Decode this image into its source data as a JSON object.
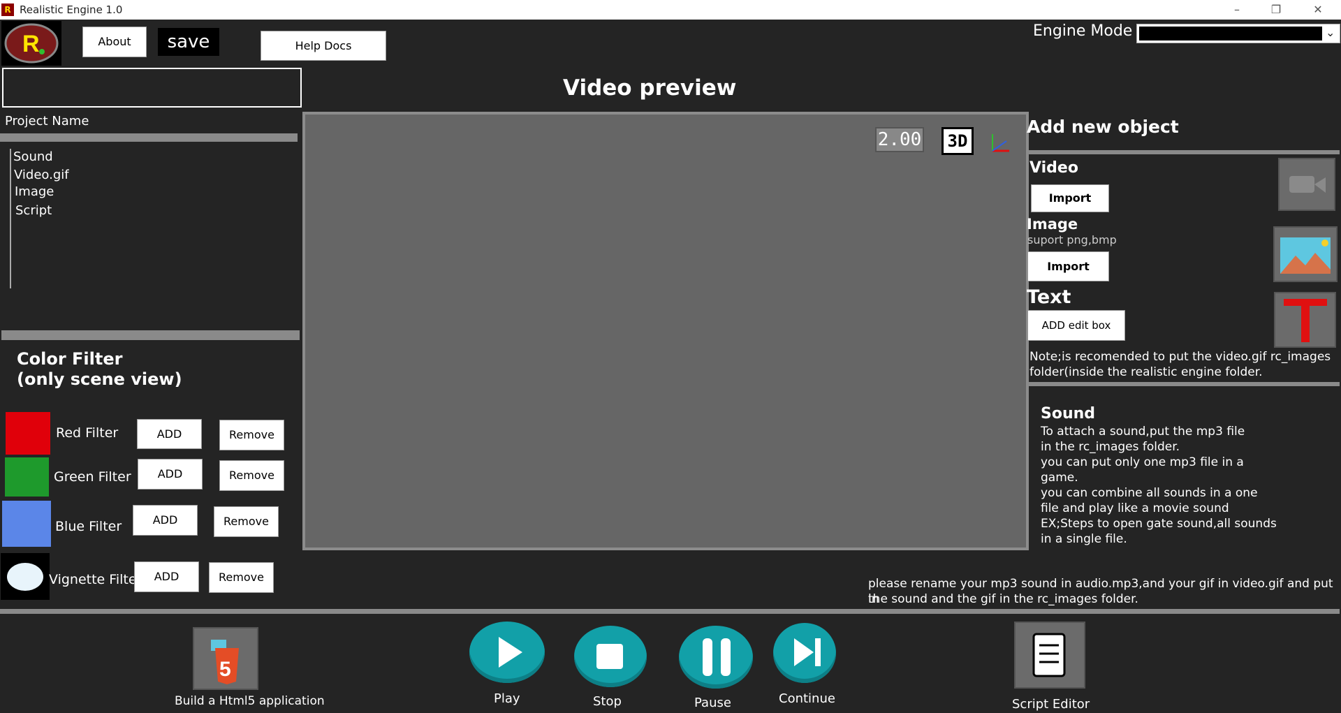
{
  "window": {
    "title": "Realistic Engine 1.0",
    "logo_letter": "R"
  },
  "toolbar": {
    "about": "About",
    "save": "save",
    "help": "Help Docs",
    "engine_mode_label": "Engine Mode",
    "engine_mode_value": ""
  },
  "project": {
    "name_label": "Project Name",
    "name_value": "",
    "items": [
      "Sound",
      "Video.gif",
      "Image",
      "Script"
    ]
  },
  "color_filter": {
    "title_line1": "Color Filter",
    "title_line2": "(only scene view)",
    "filters": [
      {
        "label": "Red Filter",
        "add": "ADD",
        "remove": "Remove",
        "color": "#e0000a"
      },
      {
        "label": "Green Filter",
        "add": "ADD",
        "remove": "Remove",
        "color": "#1e9a2c"
      },
      {
        "label": "Blue Filter",
        "add": "ADD",
        "remove": "Remove",
        "color": "#5b86e8"
      },
      {
        "label": "Vignette Filter",
        "add": "ADD",
        "remove": "Remove",
        "color": "#e8f4fb"
      }
    ]
  },
  "preview": {
    "title": "Video preview",
    "zoom_badge": "2.00",
    "mode_badge": "3D"
  },
  "add_object": {
    "title": "Add new object",
    "video_label": "Video",
    "video_import": "Import",
    "image_label": "Image",
    "image_support": "suport png,bmp",
    "image_import": "Import",
    "text_label": "Text",
    "text_button": "ADD edit box",
    "note_line1": "Note;is recomended  to put the video.gif rc_images",
    "note_line2": "folder(inside the  realistic engine folder."
  },
  "sound": {
    "title": "Sound",
    "lines": [
      "To attach a sound,put the mp3 file",
      "in the rc_images folder.",
      "you can put only one mp3 file in a",
      "game.",
      "you can combine all sounds in a one",
      "file and play like a movie sound",
      "EX;Steps to open gate sound,all sounds",
      "in a single file."
    ]
  },
  "rename_note": {
    "line1": "please rename your mp3 sound in audio.mp3,and your gif in video.gif and put in",
    "line2": "the sound and the gif in the rc_images folder."
  },
  "bottom": {
    "build_label": "Build a Html5 application",
    "play": "Play",
    "stop": "Stop",
    "pause": "Pause",
    "continue": "Continue",
    "script_editor": "Script Editor"
  },
  "colors": {
    "background": "#242424",
    "preview": "#666666",
    "accent_teal": "#12a0a8"
  }
}
